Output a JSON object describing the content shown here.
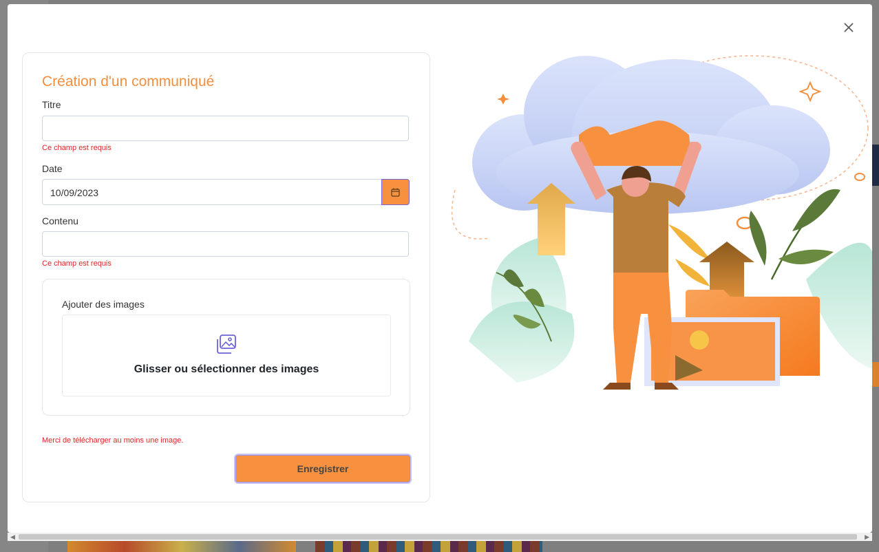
{
  "form": {
    "title": "Création d'un communiqué",
    "titre_label": "Titre",
    "titre_value": "",
    "titre_error": "Ce champ est requis",
    "date_label": "Date",
    "date_value": "10/09/2023",
    "contenu_label": "Contenu",
    "contenu_value": "",
    "contenu_error": "Ce champ est requis",
    "images_label": "Ajouter des images",
    "dropzone_text": "Glisser ou sélectionner des images",
    "images_error": "Merci de télécharger au moins une image.",
    "save_label": "Enregistrer"
  },
  "icons": {
    "close": "close-icon",
    "calendar": "calendar-icon",
    "images": "images-icon"
  },
  "colors": {
    "accent": "#f7913f",
    "error": "#e02424",
    "focus": "#7366d8"
  }
}
